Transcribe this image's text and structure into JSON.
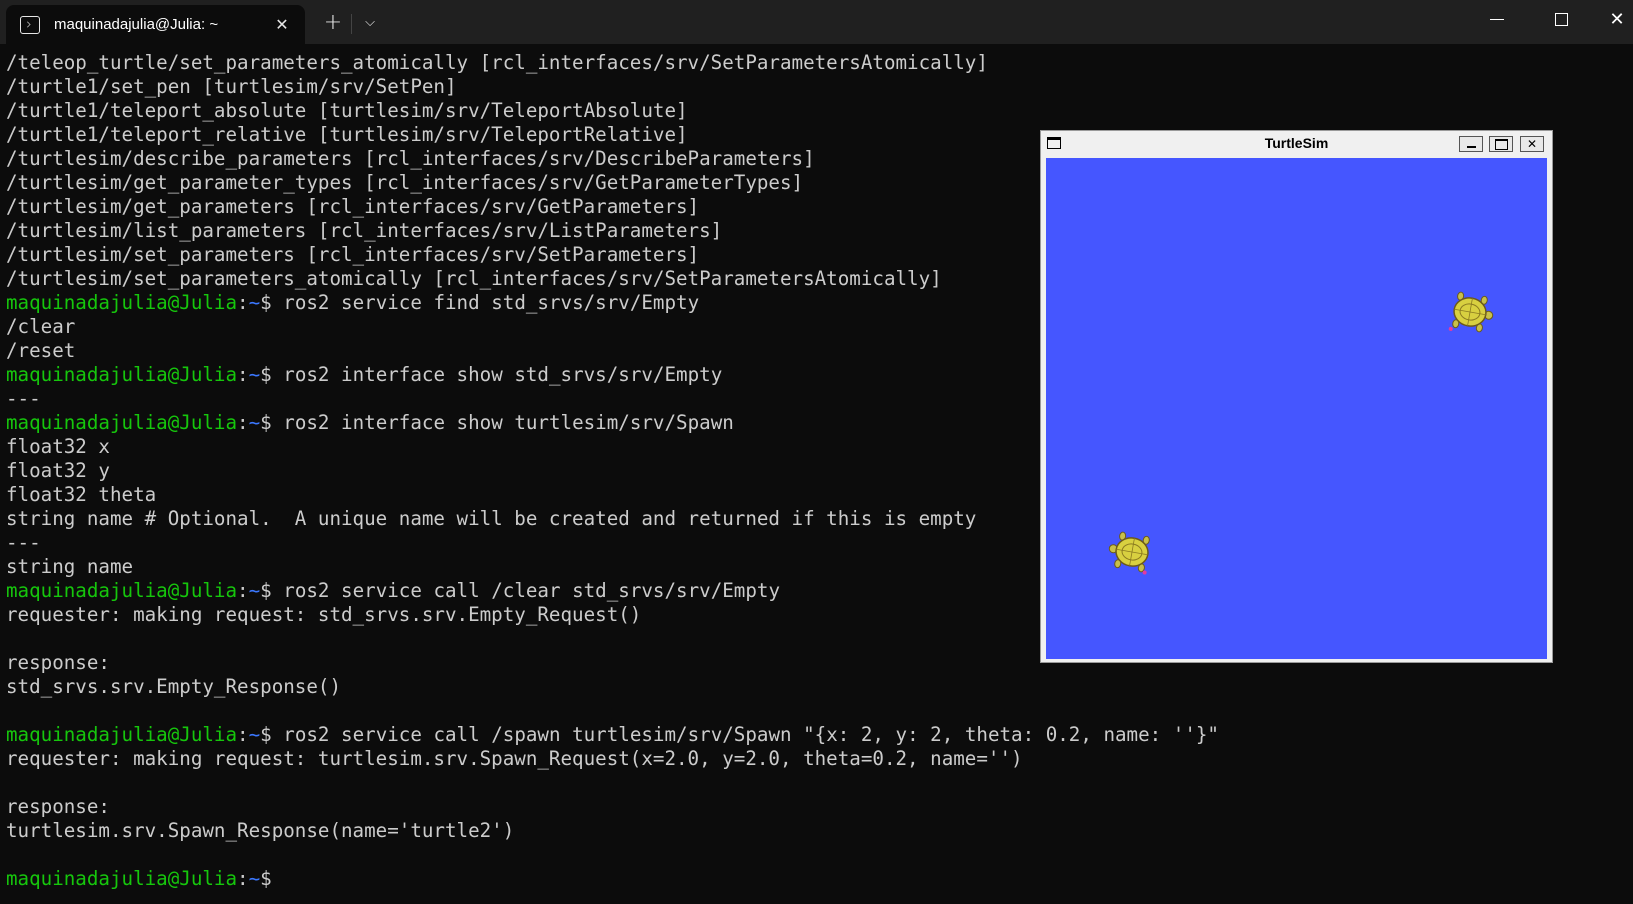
{
  "window": {
    "tab_title": "maquinadajulia@Julia: ~",
    "tab_icon": "terminal-icon",
    "new_tab_label": "+",
    "dropdown_label": "⌵",
    "close_tab_label": "✕",
    "close_window_label": "✕"
  },
  "terminal": {
    "prompt_user": "maquinadajulia@Julia",
    "prompt_path": "~",
    "lines": [
      {
        "text": "/teleop_turtle/set_parameters_atomically [rcl_interfaces/srv/SetParametersAtomically]"
      },
      {
        "text": "/turtle1/set_pen [turtlesim/srv/SetPen]"
      },
      {
        "text": "/turtle1/teleport_absolute [turtlesim/srv/TeleportAbsolute]"
      },
      {
        "text": "/turtle1/teleport_relative [turtlesim/srv/TeleportRelative]"
      },
      {
        "text": "/turtlesim/describe_parameters [rcl_interfaces/srv/DescribeParameters]"
      },
      {
        "text": "/turtlesim/get_parameter_types [rcl_interfaces/srv/GetParameterTypes]"
      },
      {
        "text": "/turtlesim/get_parameters [rcl_interfaces/srv/GetParameters]"
      },
      {
        "text": "/turtlesim/list_parameters [rcl_interfaces/srv/ListParameters]"
      },
      {
        "text": "/turtlesim/set_parameters [rcl_interfaces/srv/SetParameters]"
      },
      {
        "text": "/turtlesim/set_parameters_atomically [rcl_interfaces/srv/SetParametersAtomically]"
      },
      {
        "prompt": true,
        "text": "$ ros2 service find std_srvs/srv/Empty"
      },
      {
        "text": "/clear"
      },
      {
        "text": "/reset"
      },
      {
        "prompt": true,
        "text": "$ ros2 interface show std_srvs/srv/Empty"
      },
      {
        "text": "---"
      },
      {
        "prompt": true,
        "text": "$ ros2 interface show turtlesim/srv/Spawn"
      },
      {
        "text": "float32 x"
      },
      {
        "text": "float32 y"
      },
      {
        "text": "float32 theta"
      },
      {
        "text": "string name # Optional.  A unique name will be created and returned if this is empty"
      },
      {
        "text": "---"
      },
      {
        "text": "string name"
      },
      {
        "prompt": true,
        "text": "$ ros2 service call /clear std_srvs/srv/Empty"
      },
      {
        "text": "requester: making request: std_srvs.srv.Empty_Request()"
      },
      {
        "text": ""
      },
      {
        "text": "response:"
      },
      {
        "text": "std_srvs.srv.Empty_Response()"
      },
      {
        "text": ""
      },
      {
        "prompt": true,
        "text": "$ ros2 service call /spawn turtlesim/srv/Spawn \"{x: 2, y: 2, theta: 0.2, name: ''}\""
      },
      {
        "text": "requester: making request: turtlesim.srv.Spawn_Request(x=2.0, y=2.0, theta=0.2, name='')"
      },
      {
        "text": ""
      },
      {
        "text": "response:"
      },
      {
        "text": "turtlesim.srv.Spawn_Response(name='turtle2')"
      },
      {
        "text": ""
      },
      {
        "prompt": true,
        "text": "$"
      }
    ]
  },
  "turtlesim": {
    "title": "TurtleSim",
    "background_color": "#4556ff",
    "turtles": [
      {
        "name": "turtle1",
        "icon": "turtle-icon"
      },
      {
        "name": "turtle2",
        "icon": "turtle-icon"
      }
    ]
  },
  "colors": {
    "prompt_user": "#16c60c",
    "prompt_path": "#3b78ff",
    "text": "#cccccc",
    "background": "#0c0c0c"
  }
}
